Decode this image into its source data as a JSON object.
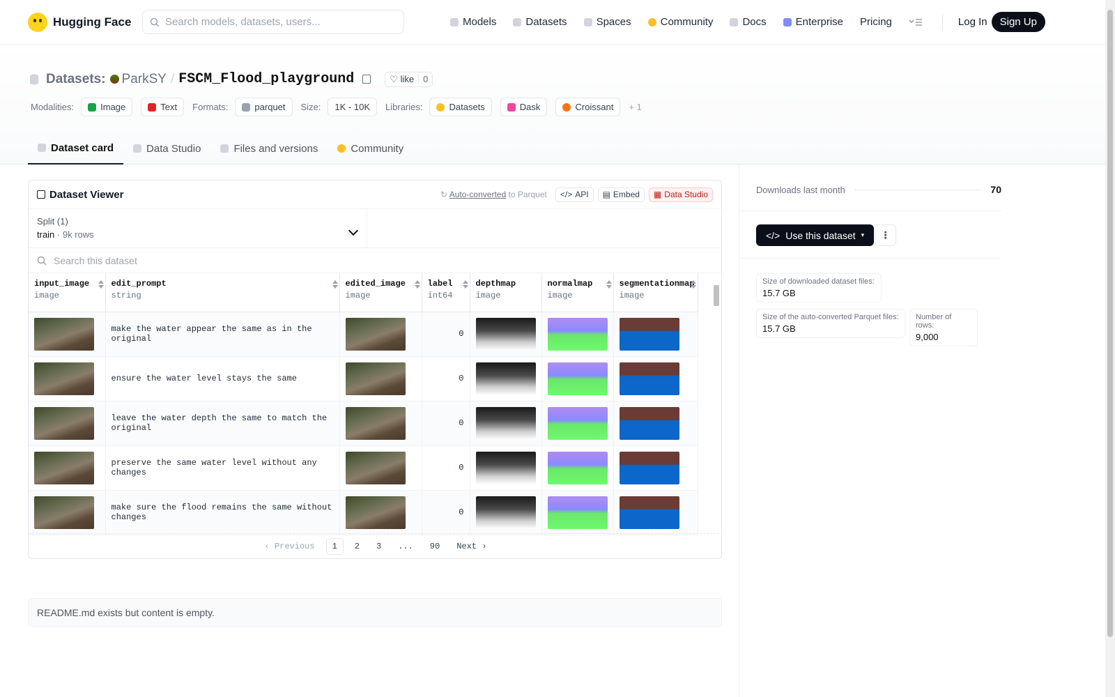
{
  "nav": {
    "brand": "Hugging Face",
    "search_placeholder": "Search models, datasets, users...",
    "links": [
      "Models",
      "Datasets",
      "Spaces",
      "Community",
      "Docs",
      "Enterprise",
      "Pricing"
    ],
    "login": "Log In",
    "signup": "Sign Up"
  },
  "repo": {
    "type_label": "Datasets:",
    "owner": "ParkSY",
    "separator": "/",
    "name": "FSCM_Flood_playground",
    "like_label": "like",
    "like_count": "0"
  },
  "tags": {
    "modalities_label": "Modalities:",
    "modalities": [
      "Image",
      "Text"
    ],
    "formats_label": "Formats:",
    "formats": [
      "parquet"
    ],
    "size_label": "Size:",
    "size": "1K - 10K",
    "libraries_label": "Libraries:",
    "libraries": [
      "Datasets",
      "Dask",
      "Croissant"
    ],
    "more": "+ 1"
  },
  "tabs": [
    "Dataset card",
    "Data Studio",
    "Files and versions",
    "Community"
  ],
  "viewer": {
    "title": "Dataset Viewer",
    "auto_converted": "Auto-converted",
    "to_parquet": "to Parquet",
    "api": "API",
    "embed": "Embed",
    "data_studio": "Data Studio",
    "split_label": "Split (1)",
    "split_name": "train",
    "split_dot": "·",
    "split_rows": "9k rows",
    "search_placeholder": "Search this dataset",
    "columns": [
      {
        "name": "input_image",
        "type": "image"
      },
      {
        "name": "edit_prompt",
        "type": "string"
      },
      {
        "name": "edited_image",
        "type": "image"
      },
      {
        "name": "label",
        "type": "int64"
      },
      {
        "name": "depthmap",
        "type": "image"
      },
      {
        "name": "normalmap",
        "type": "image"
      },
      {
        "name": "segmentationmap",
        "type": "image"
      }
    ],
    "rows": [
      {
        "prompt": "make the water appear the same as in the original",
        "label": "0"
      },
      {
        "prompt": "ensure the water level stays the same",
        "label": "0"
      },
      {
        "prompt": "leave the water depth the same to match the original",
        "label": "0"
      },
      {
        "prompt": "preserve the same water level without any changes",
        "label": "0"
      },
      {
        "prompt": "make sure the flood remains the same without changes",
        "label": "0"
      }
    ],
    "pager": {
      "prev": "Previous",
      "pages": [
        "1",
        "2",
        "3",
        "...",
        "90"
      ],
      "next": "Next"
    }
  },
  "readme_text": "README.md exists but content is empty.",
  "sidebar": {
    "downloads_label": "Downloads last month",
    "downloads_value": "70",
    "use_button": "Use this dataset",
    "kebab": "⋮",
    "stats": [
      {
        "label": "Size of downloaded dataset files:",
        "value": "15.7 GB"
      },
      {
        "label": "Size of the auto-converted Parquet files:",
        "value": "15.7 GB"
      },
      {
        "label": "Number of rows:",
        "value": "9,000"
      }
    ]
  }
}
